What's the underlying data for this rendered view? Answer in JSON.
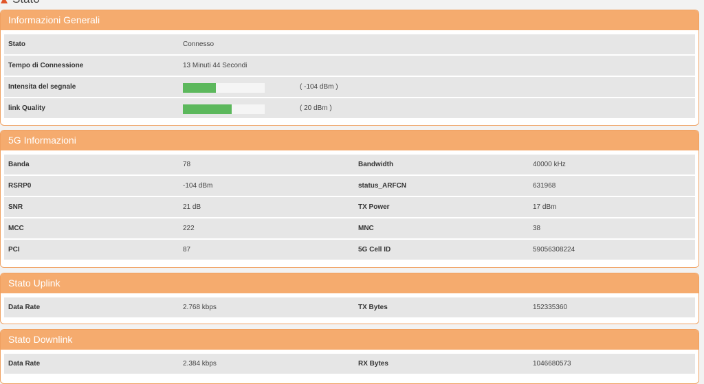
{
  "page": {
    "title": "Stato"
  },
  "general": {
    "title": "Informazioni Generali",
    "rows": [
      {
        "label": "Stato",
        "value": "Connesso"
      },
      {
        "label": "Tempo di Connessione",
        "value": "13 Minuti 44 Secondi"
      }
    ],
    "signal": {
      "label": "Intensita del segnale",
      "dbm": "( -104 dBm )",
      "level": 0.4
    },
    "quality": {
      "label": "link Quality",
      "dbm": "( 20 dBm )",
      "level": 0.6
    }
  },
  "info5g": {
    "title": "5G Informazioni",
    "rows": [
      {
        "l1": "Banda",
        "v1": "78",
        "l2": "Bandwidth",
        "v2": "40000 kHz"
      },
      {
        "l1": "RSRP0",
        "v1": "-104 dBm",
        "l2": "status_ARFCN",
        "v2": "631968"
      },
      {
        "l1": "SNR",
        "v1": "21 dB",
        "l2": "TX Power",
        "v2": "17 dBm"
      },
      {
        "l1": "MCC",
        "v1": "222",
        "l2": "MNC",
        "v2": "38"
      },
      {
        "l1": "PCI",
        "v1": "87",
        "l2": "5G Cell ID",
        "v2": "59056308224"
      }
    ]
  },
  "uplink": {
    "title": "Stato Uplink",
    "rows": [
      {
        "l1": "Data Rate",
        "v1": "2.768 kbps",
        "l2": "TX Bytes",
        "v2": "152335360"
      }
    ]
  },
  "downlink": {
    "title": "Stato Downlink",
    "rows": [
      {
        "l1": "Data Rate",
        "v1": "2.384 kbps",
        "l2": "RX Bytes",
        "v2": "1046680573"
      }
    ]
  },
  "colors": {
    "header": "#f5ab6e",
    "border": "#f0a060",
    "bar": "#5cb85c",
    "row": "#e6e6e6"
  }
}
